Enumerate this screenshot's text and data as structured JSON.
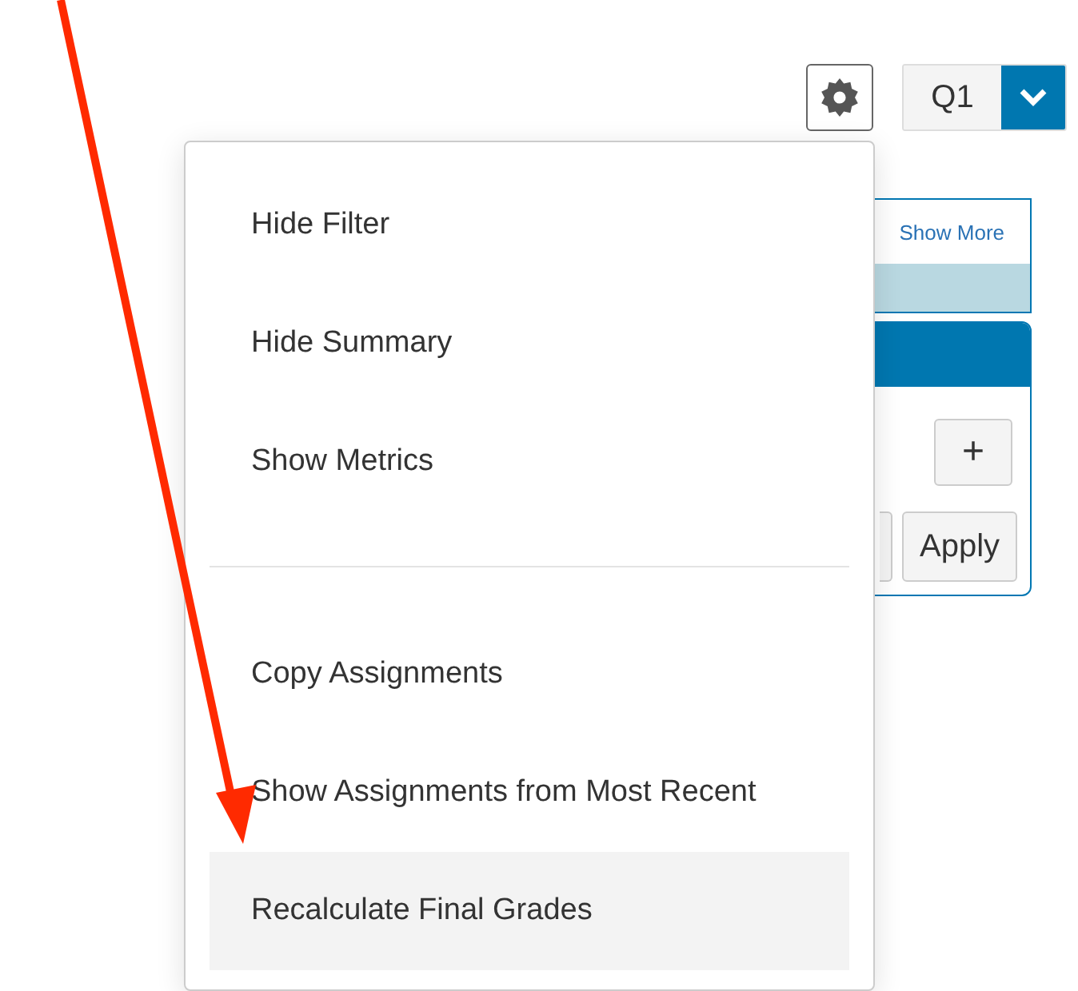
{
  "toolbar": {
    "period_select": {
      "value": "Q1"
    }
  },
  "filter_panel": {
    "show_more_link": "Show More",
    "add_button": "+",
    "apply_button": "Apply"
  },
  "settings_menu": {
    "items": [
      {
        "kind": "item",
        "label": "Hide Filter",
        "highlighted": false
      },
      {
        "kind": "item",
        "label": "Hide Summary",
        "highlighted": false
      },
      {
        "kind": "item",
        "label": "Show Metrics",
        "highlighted": false
      },
      {
        "kind": "divider"
      },
      {
        "kind": "item",
        "label": "Copy Assignments",
        "highlighted": false
      },
      {
        "kind": "item",
        "label": "Show Assignments from Most Recent",
        "highlighted": false
      },
      {
        "kind": "item",
        "label": "Recalculate Final Grades",
        "highlighted": true
      }
    ]
  }
}
